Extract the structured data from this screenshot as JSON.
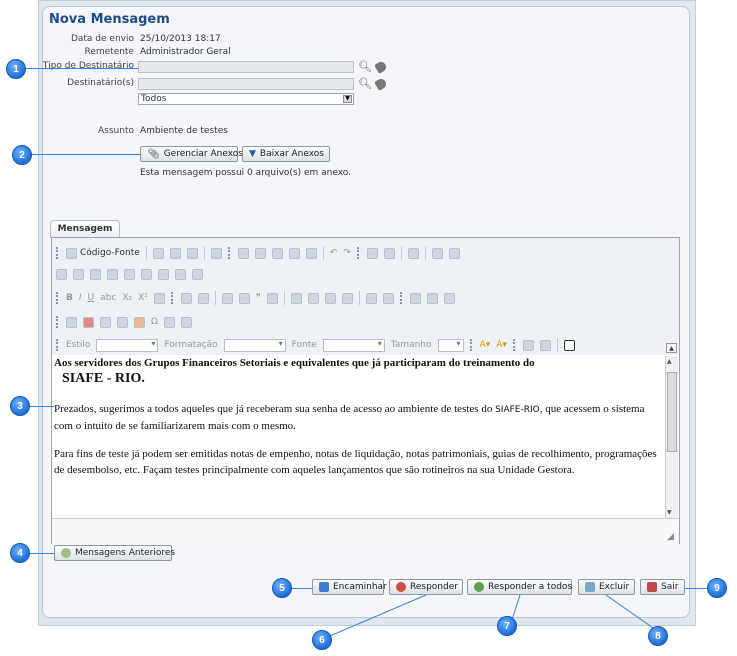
{
  "form": {
    "title": "Nova Mensagem",
    "labels": {
      "data_envio": "Data de envio",
      "remetente": "Remetente",
      "tipo_destinatario": "Tipo de Destinatário",
      "destinatarios": "Destinatário(s)",
      "assunto": "Assunto"
    },
    "values": {
      "data_envio": "25/10/2013 18:17",
      "remetente": "Administrador Geral",
      "todos": "Todos",
      "assunto": "Ambiente de testes"
    },
    "buttons": {
      "gerenciar_anexos": "Gerenciar Anexos",
      "baixar_anexos": "Baixar Anexos"
    },
    "attachments_info": "Esta mensagem possui 0 arquivo(s) em anexo."
  },
  "editor": {
    "tab_label": "Mensagem",
    "toolbar": {
      "codigo_fonte": "Código-Fonte",
      "estilo": "Estilo",
      "formatacao": "Formatação",
      "fonte": "Fonte",
      "tamanho": "Tamanho"
    },
    "content": {
      "heading": "Aos servidores dos Grupos Financeiros Setoriais e equivalentes que já participaram do treinamento do",
      "heading_big": "SIAFE - RIO.",
      "p1_start": "Prezados, sugerimos a todos aqueles que já receberam sua senha de acesso ao ambiente de testes do ",
      "p1_mono": "SIAFE-RIO",
      "p1_end": ", que acessem o sistema com o intuito de se familiarizarem mais com o mesmo.",
      "p2": "Para fins de teste já podem ser emitidas notas de empenho, notas de liquidação, notas patrimoniais, guias de recolhimento, programações de desembolso, etc. Façam testes principalmente com aqueles lançamentos que são rotineiros na sua Unidade Gestora."
    }
  },
  "buttons": {
    "mensagens_anteriores": "Mensagens Anteriores",
    "encaminhar": "Encaminhar",
    "responder": "Responder",
    "responder_todos": "Responder a todos",
    "excluir": "Excluir",
    "sair": "Sair"
  },
  "callouts": [
    "1",
    "2",
    "3",
    "4",
    "5",
    "6",
    "7",
    "8",
    "9"
  ],
  "colors": {
    "callout": "#1d6fd6",
    "title": "#1b4d8a",
    "accent_line": "#3b82e0"
  }
}
